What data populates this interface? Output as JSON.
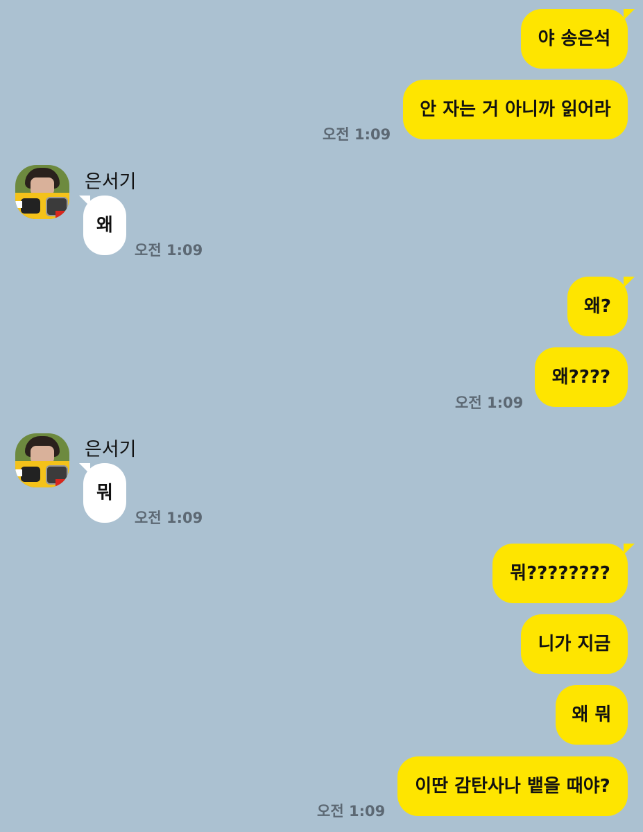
{
  "messages": [
    {
      "from": "me",
      "text": "야 송은석"
    },
    {
      "from": "me",
      "text": "안 자는 거 아니까 읽어라",
      "time": "오전 1:09"
    },
    {
      "from": "them",
      "sender": "은서기",
      "text": "왜",
      "time": "오전 1:09"
    },
    {
      "from": "me",
      "text": "왜?"
    },
    {
      "from": "me",
      "text": "왜????",
      "time": "오전 1:09"
    },
    {
      "from": "them",
      "sender": "은서기",
      "text": "뭐",
      "time": "오전 1:09"
    },
    {
      "from": "me",
      "text": "뭐????????"
    },
    {
      "from": "me",
      "text": "니가 지금"
    },
    {
      "from": "me",
      "text": "왜 뭐"
    },
    {
      "from": "me",
      "text": "이딴 감탄사나 뱉을 때야?",
      "time": "오전 1:09"
    }
  ],
  "colors": {
    "background": "#abc1d1",
    "my_bubble": "#fee500",
    "their_bubble": "#ffffff",
    "timestamp": "#5c6873"
  },
  "icons": {
    "avatar": "profile-photo-avatar-icon"
  }
}
